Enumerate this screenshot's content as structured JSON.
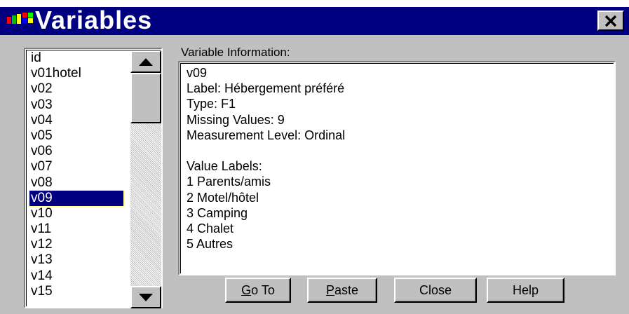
{
  "window": {
    "title": "Variables",
    "close_icon": "close-x-icon",
    "app_icon": "spss-window-icon"
  },
  "variable_list": {
    "items": [
      "id",
      "v01hotel",
      "v02",
      "v03",
      "v04",
      "v05",
      "v06",
      "v07",
      "v08",
      "v09",
      "v10",
      "v11",
      "v12",
      "v13",
      "v14",
      "v15"
    ],
    "selected": "v09",
    "scroll_up_icon": "triangle-up-icon",
    "scroll_down_icon": "triangle-down-icon"
  },
  "info": {
    "heading": "Variable Information:",
    "lines": [
      "v09",
      "Label:  Hébergement préféré",
      "Type:  F1",
      "Missing Values:  9",
      "Measurement Level:  Ordinal",
      "",
      "Value Labels:",
      "1 Parents/amis",
      "2 Motel/hôtel",
      "3 Camping",
      "4 Chalet",
      "5 Autres"
    ]
  },
  "buttons": {
    "goto_mnemonic": "G",
    "goto_rest": "o To",
    "paste_mnemonic": "P",
    "paste_rest": "aste",
    "close": "Close",
    "help": "Help"
  },
  "colors": {
    "titlebar": "#000080",
    "face": "#c0c0c0",
    "selection": "#000080"
  }
}
